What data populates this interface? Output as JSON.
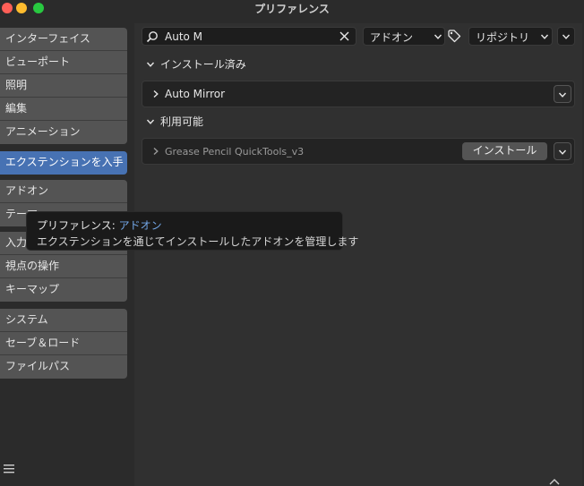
{
  "window": {
    "title": "プリファレンス"
  },
  "sidebar": {
    "groups": [
      {
        "items": [
          {
            "label": "インターフェイス"
          },
          {
            "label": "ビューポート"
          },
          {
            "label": "照明"
          },
          {
            "label": "編集"
          },
          {
            "label": "アニメーション"
          }
        ]
      },
      {
        "items": [
          {
            "label": "エクステンションを入手",
            "active": true
          }
        ]
      },
      {
        "items": [
          {
            "label": "アドオン"
          },
          {
            "label": "テーマ"
          }
        ]
      },
      {
        "items": [
          {
            "label": "入力"
          },
          {
            "label": "視点の操作"
          },
          {
            "label": "キーマップ"
          }
        ]
      },
      {
        "items": [
          {
            "label": "システム"
          },
          {
            "label": "セーブ＆ロード"
          },
          {
            "label": "ファイルパス"
          }
        ]
      }
    ]
  },
  "toolbar": {
    "search_value": "Auto M",
    "type_filter": "アドオン",
    "repo_filter": "リポジトリ"
  },
  "sections": {
    "installed": {
      "title": "インストール済み",
      "items": [
        {
          "name": "Auto Mirror"
        }
      ]
    },
    "available": {
      "title": "利用可能",
      "items": [
        {
          "name": "Grease Pencil QuickTools_v3",
          "install_label": "インストール"
        }
      ]
    }
  },
  "tooltip": {
    "prefix": "プリファレンス: ",
    "link": "アドオン",
    "description": "エクステンションを通じてインストールしたアドオンを管理します"
  },
  "colors": {
    "accent": "#4772b3",
    "link": "#73a7e8"
  }
}
